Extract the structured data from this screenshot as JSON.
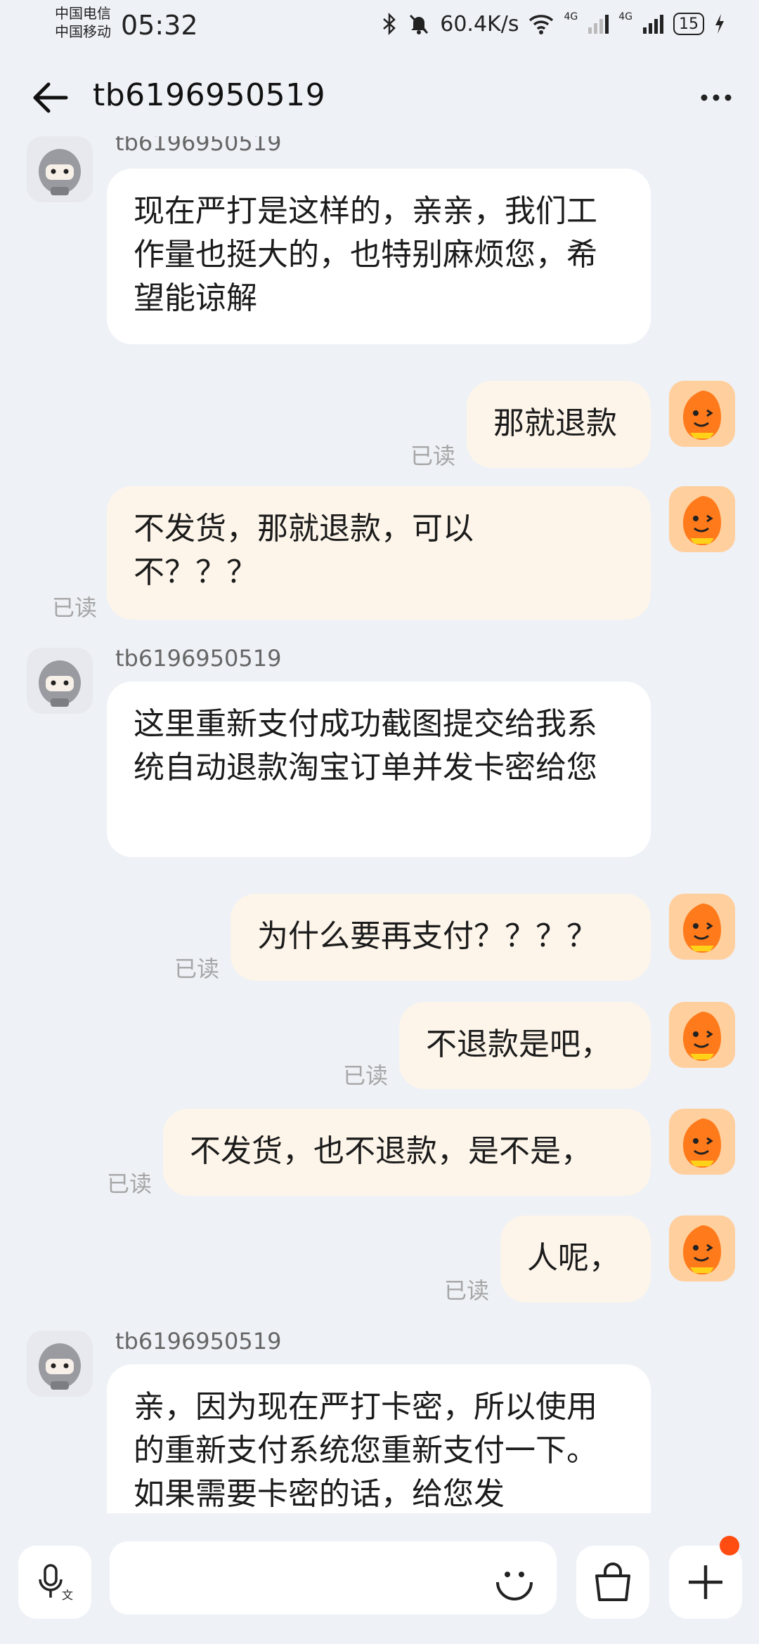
{
  "status": {
    "carrier1": "中国电信",
    "carrier2": "中国移动",
    "time": "05:32",
    "speed": "60.4K/s",
    "net1": "4G",
    "net2": "4G",
    "battery": "15"
  },
  "header": {
    "title": "tb6196950519"
  },
  "chat": {
    "contact_name": "tb6196950519",
    "read_label": "已读",
    "messages": [
      {
        "side": "in",
        "text": "现在严打是这样的，亲亲，我们工作量也挺大的，也特别麻烦您，希望能谅解"
      },
      {
        "side": "out",
        "text": "那就退款",
        "status": "已读"
      },
      {
        "side": "out",
        "text": "不发货，那就退款，可以不？？？",
        "status": "已读"
      },
      {
        "side": "in",
        "name": "tb6196950519",
        "text": "这里重新支付成功截图提交给我系统自动退款淘宝订单并发卡密给您"
      },
      {
        "side": "out",
        "text": "为什么要再支付？？？？",
        "status": "已读"
      },
      {
        "side": "out",
        "text": "不退款是吧，",
        "status": "已读"
      },
      {
        "side": "out",
        "text": "不发货，也不退款，是不是，",
        "status": "已读"
      },
      {
        "side": "out",
        "text": "人呢，",
        "status": "已读"
      },
      {
        "side": "in",
        "name": "tb6196950519",
        "text": "亲，因为现在严打卡密，所以使用的重新支付系统您重新支付一下。如果需要卡密的话，给您发"
      }
    ]
  },
  "input": {
    "placeholder": ""
  },
  "icons": {
    "back": "back-arrow-icon",
    "more": "more-dots-icon",
    "voice": "voice-translate-icon",
    "emoji": "emoji-icon",
    "shop": "shopping-bag-icon",
    "plus": "plus-icon"
  },
  "colors": {
    "background": "#eef1f6",
    "incoming_bubble": "#ffffff",
    "outgoing_bubble": "#fdf5ea",
    "read_text": "#a6a6a6",
    "notification_dot": "#ff4d12"
  }
}
